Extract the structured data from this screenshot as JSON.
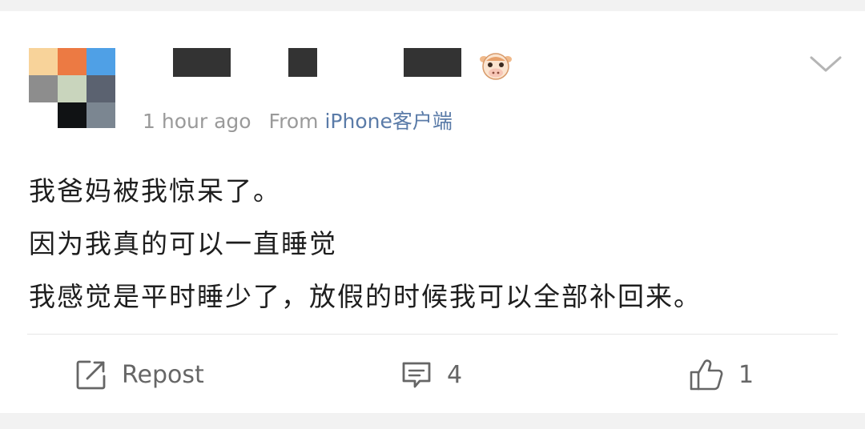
{
  "post": {
    "timestamp": "1 hour ago",
    "from_label": "From",
    "source": "iPhone客户端",
    "lines": [
      "我爸妈被我惊呆了。",
      "因为我真的可以一直睡觉",
      "我感觉是平时睡少了，放假的时候我可以全部补回来。"
    ]
  },
  "actions": {
    "repost_label": "Repost",
    "comment_count": "4",
    "like_count": "1"
  },
  "icons": {
    "badge": "cow-emoji-icon",
    "menu": "chevron-down-icon",
    "repost": "repost-icon",
    "comment": "comment-icon",
    "like": "thumbs-up-icon"
  },
  "colors": {
    "source_link": "#5a7ba8",
    "meta_text": "#9a9a9a",
    "action_text": "#666666"
  }
}
